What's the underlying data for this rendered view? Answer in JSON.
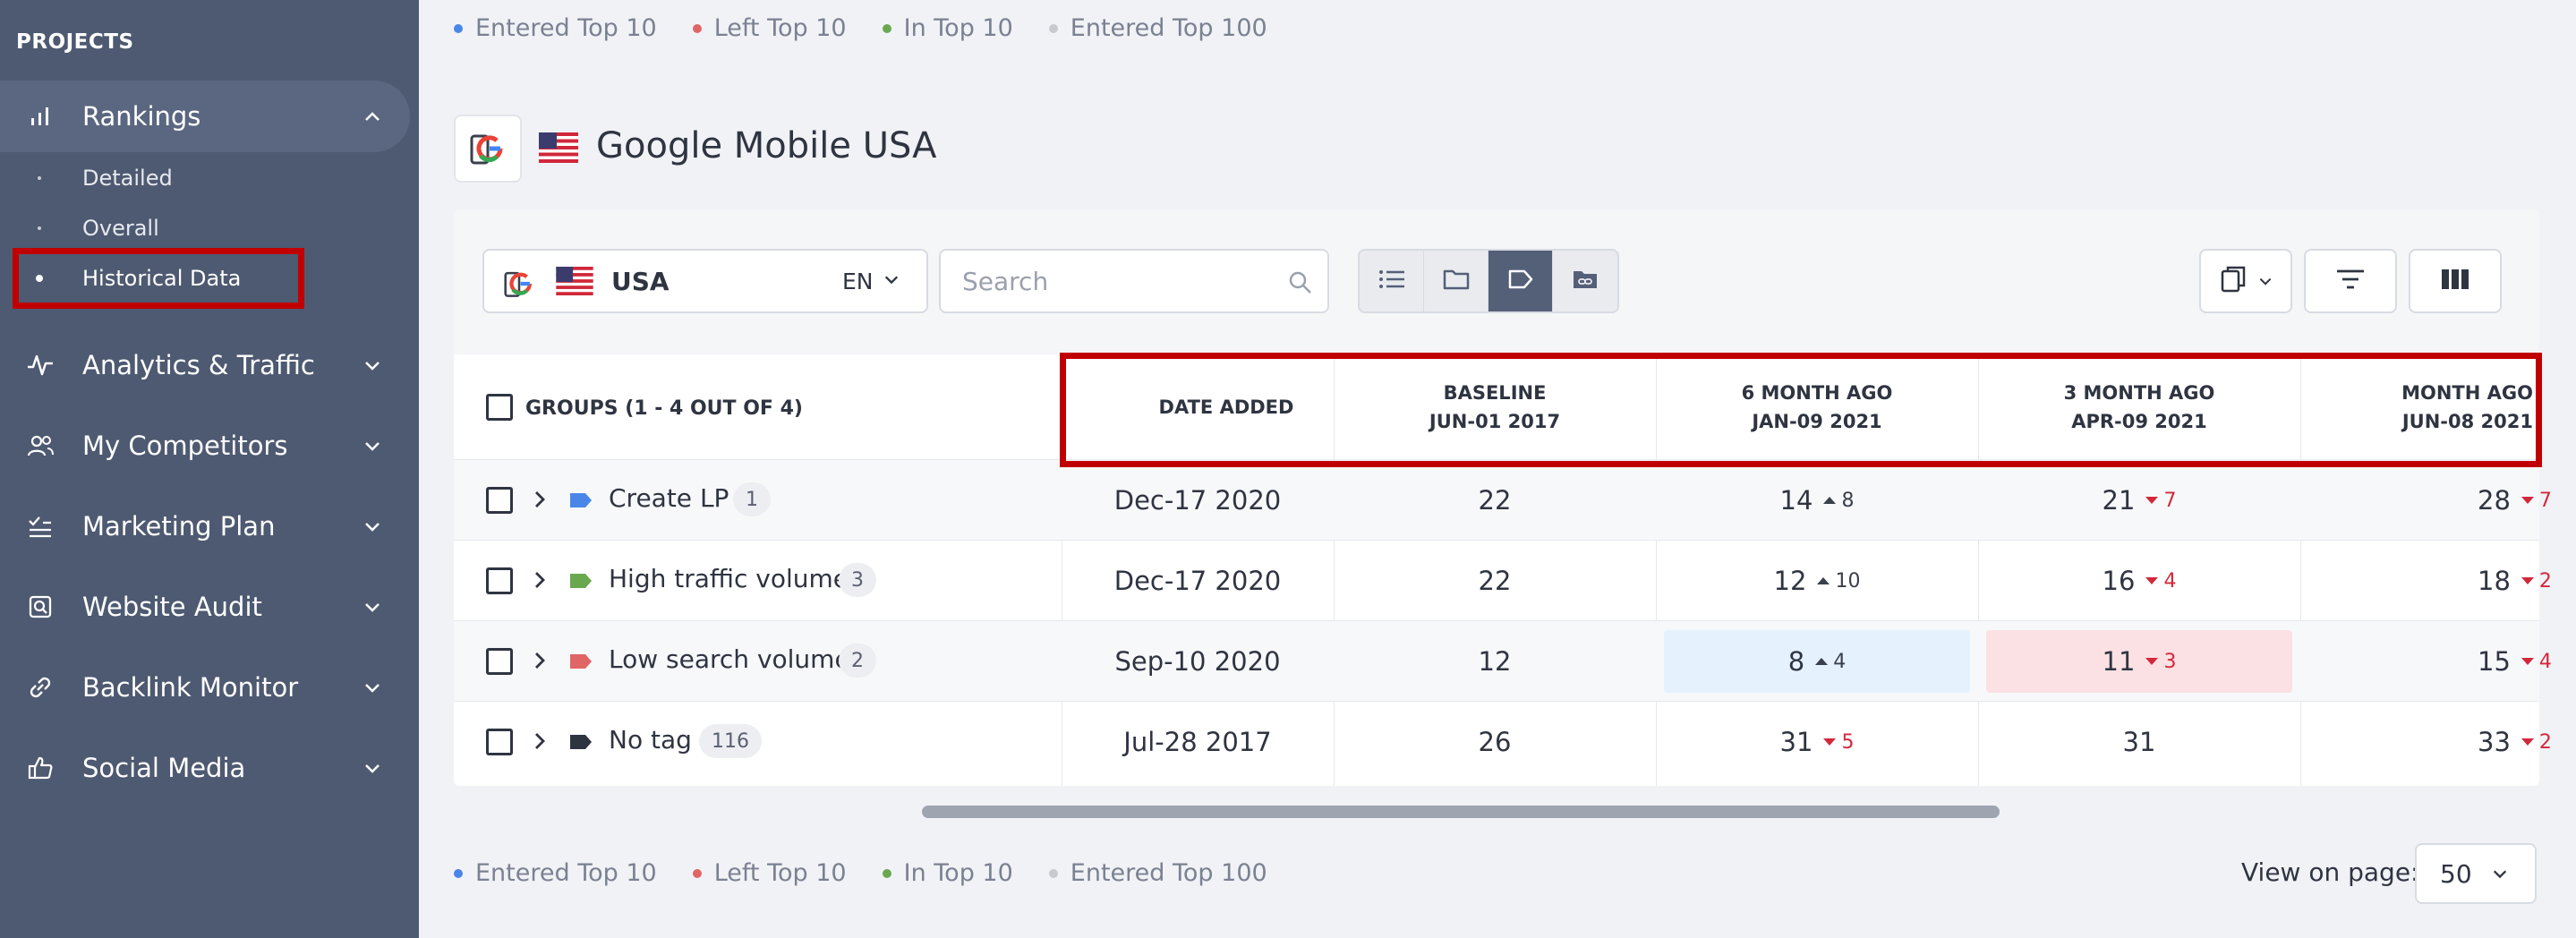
{
  "sidebar": {
    "header": "PROJECTS",
    "items": [
      {
        "label": "Rankings",
        "icon": "bar-chart-icon"
      },
      {
        "label": "Analytics & Traffic",
        "icon": "activity-icon"
      },
      {
        "label": "My Competitors",
        "icon": "users-icon"
      },
      {
        "label": "Marketing Plan",
        "icon": "checklist-icon"
      },
      {
        "label": "Website Audit",
        "icon": "audit-icon"
      },
      {
        "label": "Backlink Monitor",
        "icon": "link-icon"
      },
      {
        "label": "Social Media",
        "icon": "thumbs-up-icon"
      }
    ],
    "sub_items": [
      {
        "label": "Detailed"
      },
      {
        "label": "Overall"
      },
      {
        "label": "Historical Data"
      }
    ]
  },
  "legend": [
    {
      "label": "Entered Top 10",
      "color": "#4a86e8"
    },
    {
      "label": "Left Top 10",
      "color": "#e06666"
    },
    {
      "label": "In Top 10",
      "color": "#6aa84f"
    },
    {
      "label": "Entered Top 100",
      "color": "#c7c9cf"
    }
  ],
  "project": {
    "title": "Google Mobile USA"
  },
  "toolbar": {
    "country": "USA",
    "language": "EN",
    "search_placeholder": "Search"
  },
  "table": {
    "groups_header": "GROUPS (1 - 4 OUT OF 4)",
    "columns": [
      {
        "title": "DATE ADDED",
        "sub": ""
      },
      {
        "title": "BASELINE",
        "sub": "JUN-01 2017"
      },
      {
        "title": "6 MONTH AGO",
        "sub": "JAN-09 2021"
      },
      {
        "title": "3 MONTH AGO",
        "sub": "APR-09 2021"
      },
      {
        "title": "MONTH AGO",
        "sub": "JUN-08 2021"
      }
    ],
    "rows": [
      {
        "name": "Create LP",
        "count": "1",
        "tag_color": "#4a86e8",
        "date_added": "Dec-17 2020",
        "baseline": "22",
        "m6": {
          "value": "14",
          "change": "8",
          "dir": "up"
        },
        "m3": {
          "value": "21",
          "change": "7",
          "dir": "down"
        },
        "m1": {
          "value": "28",
          "change": "7",
          "dir": "down"
        }
      },
      {
        "name": "High traffic volume",
        "count": "3",
        "tag_color": "#6aa84f",
        "date_added": "Dec-17 2020",
        "baseline": "22",
        "m6": {
          "value": "12",
          "change": "10",
          "dir": "up"
        },
        "m3": {
          "value": "16",
          "change": "4",
          "dir": "down"
        },
        "m1": {
          "value": "18",
          "change": "2",
          "dir": "down"
        }
      },
      {
        "name": "Low search volume",
        "count": "2",
        "tag_color": "#e06666",
        "date_added": "Sep-10 2020",
        "baseline": "12",
        "m6": {
          "value": "8",
          "change": "4",
          "dir": "up"
        },
        "m3": {
          "value": "11",
          "change": "3",
          "dir": "down"
        },
        "m1": {
          "value": "15",
          "change": "4",
          "dir": "down"
        }
      },
      {
        "name": "No tag",
        "count": "116",
        "tag_color": "#2f3441",
        "date_added": "Jul-28 2017",
        "baseline": "26",
        "m6": {
          "value": "31",
          "change": "5",
          "dir": "down"
        },
        "m3": {
          "value": "31",
          "change": "",
          "dir": ""
        },
        "m1": {
          "value": "33",
          "change": "2",
          "dir": "down"
        }
      }
    ]
  },
  "footer": {
    "view_on_page_label": "View on page:",
    "view_on_page_value": "50"
  }
}
